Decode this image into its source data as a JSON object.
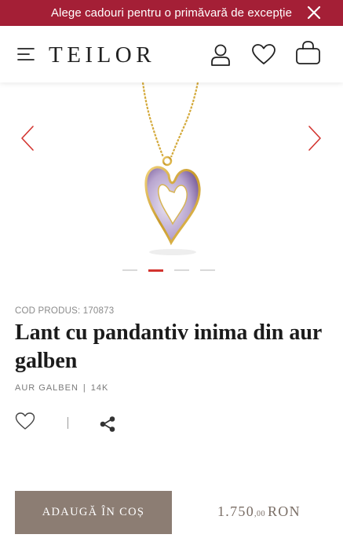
{
  "promo": {
    "text": "Alege cadouri pentru o primăvară de excepție"
  },
  "header": {
    "logo": "TEILOR"
  },
  "gallery": {
    "slide_count": 4,
    "active_slide": 2
  },
  "product": {
    "code_label": "COD PRODUS: 170873",
    "title": "Lant cu pandantiv inima din aur galben",
    "material": "AUR GALBEN",
    "purity": "14K",
    "separator": "|"
  },
  "purchase": {
    "add_to_cart_label": "ADAUGĂ ÎN COȘ",
    "price_main": "1.750",
    "price_cents": ",00",
    "currency": "RON"
  },
  "colors": {
    "promo_bg": "#a41f36",
    "accent_red": "#d3342f",
    "button_bg": "#8c7d73",
    "price_text": "#7a6e66"
  },
  "icons": [
    "close-icon",
    "menu-icon",
    "user-icon",
    "heart-icon",
    "shopping-bag-icon",
    "chevron-left-icon",
    "chevron-right-icon",
    "share-icon"
  ]
}
